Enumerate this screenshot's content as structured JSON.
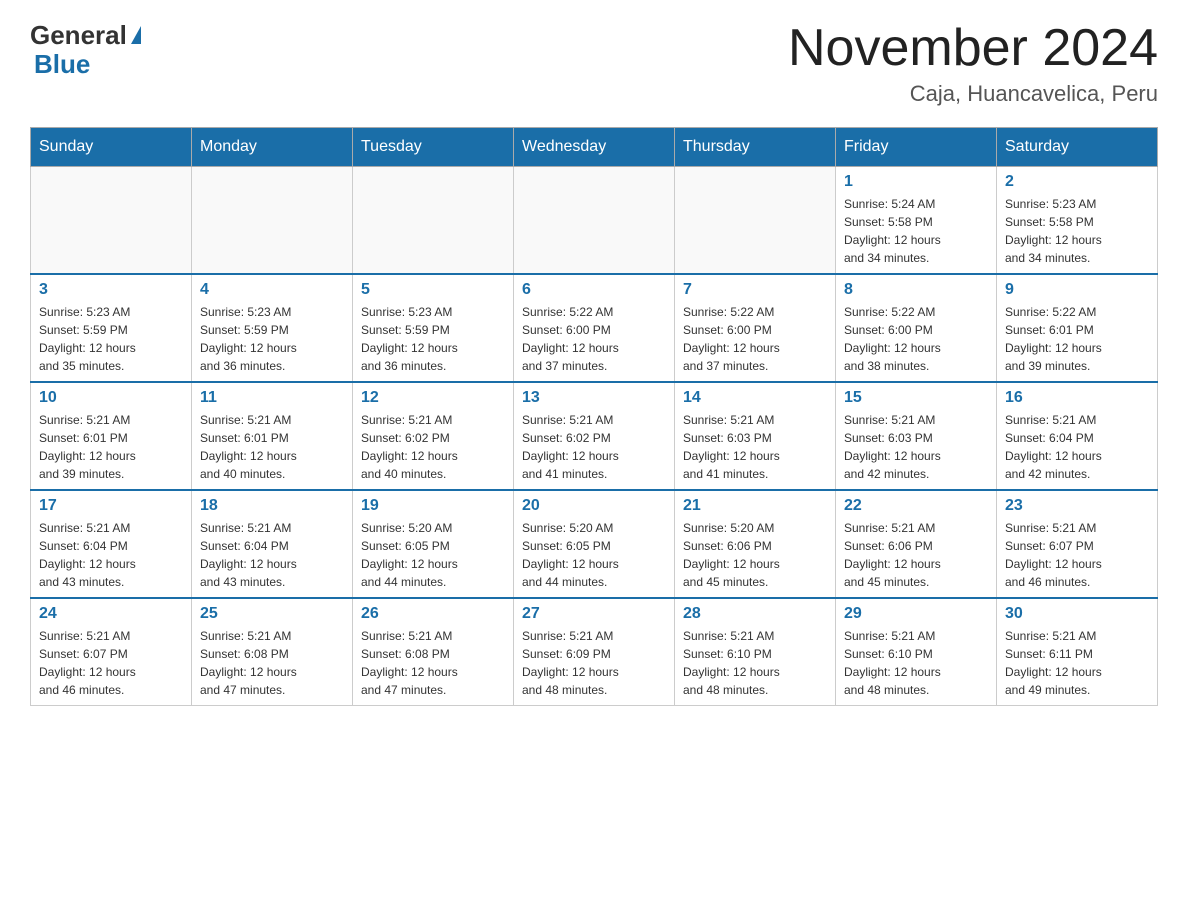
{
  "header": {
    "logo_general": "General",
    "logo_blue": "Blue",
    "month_title": "November 2024",
    "location": "Caja, Huancavelica, Peru"
  },
  "weekdays": [
    "Sunday",
    "Monday",
    "Tuesday",
    "Wednesday",
    "Thursday",
    "Friday",
    "Saturday"
  ],
  "weeks": [
    [
      {
        "day": "",
        "info": ""
      },
      {
        "day": "",
        "info": ""
      },
      {
        "day": "",
        "info": ""
      },
      {
        "day": "",
        "info": ""
      },
      {
        "day": "",
        "info": ""
      },
      {
        "day": "1",
        "info": "Sunrise: 5:24 AM\nSunset: 5:58 PM\nDaylight: 12 hours\nand 34 minutes."
      },
      {
        "day": "2",
        "info": "Sunrise: 5:23 AM\nSunset: 5:58 PM\nDaylight: 12 hours\nand 34 minutes."
      }
    ],
    [
      {
        "day": "3",
        "info": "Sunrise: 5:23 AM\nSunset: 5:59 PM\nDaylight: 12 hours\nand 35 minutes."
      },
      {
        "day": "4",
        "info": "Sunrise: 5:23 AM\nSunset: 5:59 PM\nDaylight: 12 hours\nand 36 minutes."
      },
      {
        "day": "5",
        "info": "Sunrise: 5:23 AM\nSunset: 5:59 PM\nDaylight: 12 hours\nand 36 minutes."
      },
      {
        "day": "6",
        "info": "Sunrise: 5:22 AM\nSunset: 6:00 PM\nDaylight: 12 hours\nand 37 minutes."
      },
      {
        "day": "7",
        "info": "Sunrise: 5:22 AM\nSunset: 6:00 PM\nDaylight: 12 hours\nand 37 minutes."
      },
      {
        "day": "8",
        "info": "Sunrise: 5:22 AM\nSunset: 6:00 PM\nDaylight: 12 hours\nand 38 minutes."
      },
      {
        "day": "9",
        "info": "Sunrise: 5:22 AM\nSunset: 6:01 PM\nDaylight: 12 hours\nand 39 minutes."
      }
    ],
    [
      {
        "day": "10",
        "info": "Sunrise: 5:21 AM\nSunset: 6:01 PM\nDaylight: 12 hours\nand 39 minutes."
      },
      {
        "day": "11",
        "info": "Sunrise: 5:21 AM\nSunset: 6:01 PM\nDaylight: 12 hours\nand 40 minutes."
      },
      {
        "day": "12",
        "info": "Sunrise: 5:21 AM\nSunset: 6:02 PM\nDaylight: 12 hours\nand 40 minutes."
      },
      {
        "day": "13",
        "info": "Sunrise: 5:21 AM\nSunset: 6:02 PM\nDaylight: 12 hours\nand 41 minutes."
      },
      {
        "day": "14",
        "info": "Sunrise: 5:21 AM\nSunset: 6:03 PM\nDaylight: 12 hours\nand 41 minutes."
      },
      {
        "day": "15",
        "info": "Sunrise: 5:21 AM\nSunset: 6:03 PM\nDaylight: 12 hours\nand 42 minutes."
      },
      {
        "day": "16",
        "info": "Sunrise: 5:21 AM\nSunset: 6:04 PM\nDaylight: 12 hours\nand 42 minutes."
      }
    ],
    [
      {
        "day": "17",
        "info": "Sunrise: 5:21 AM\nSunset: 6:04 PM\nDaylight: 12 hours\nand 43 minutes."
      },
      {
        "day": "18",
        "info": "Sunrise: 5:21 AM\nSunset: 6:04 PM\nDaylight: 12 hours\nand 43 minutes."
      },
      {
        "day": "19",
        "info": "Sunrise: 5:20 AM\nSunset: 6:05 PM\nDaylight: 12 hours\nand 44 minutes."
      },
      {
        "day": "20",
        "info": "Sunrise: 5:20 AM\nSunset: 6:05 PM\nDaylight: 12 hours\nand 44 minutes."
      },
      {
        "day": "21",
        "info": "Sunrise: 5:20 AM\nSunset: 6:06 PM\nDaylight: 12 hours\nand 45 minutes."
      },
      {
        "day": "22",
        "info": "Sunrise: 5:21 AM\nSunset: 6:06 PM\nDaylight: 12 hours\nand 45 minutes."
      },
      {
        "day": "23",
        "info": "Sunrise: 5:21 AM\nSunset: 6:07 PM\nDaylight: 12 hours\nand 46 minutes."
      }
    ],
    [
      {
        "day": "24",
        "info": "Sunrise: 5:21 AM\nSunset: 6:07 PM\nDaylight: 12 hours\nand 46 minutes."
      },
      {
        "day": "25",
        "info": "Sunrise: 5:21 AM\nSunset: 6:08 PM\nDaylight: 12 hours\nand 47 minutes."
      },
      {
        "day": "26",
        "info": "Sunrise: 5:21 AM\nSunset: 6:08 PM\nDaylight: 12 hours\nand 47 minutes."
      },
      {
        "day": "27",
        "info": "Sunrise: 5:21 AM\nSunset: 6:09 PM\nDaylight: 12 hours\nand 48 minutes."
      },
      {
        "day": "28",
        "info": "Sunrise: 5:21 AM\nSunset: 6:10 PM\nDaylight: 12 hours\nand 48 minutes."
      },
      {
        "day": "29",
        "info": "Sunrise: 5:21 AM\nSunset: 6:10 PM\nDaylight: 12 hours\nand 48 minutes."
      },
      {
        "day": "30",
        "info": "Sunrise: 5:21 AM\nSunset: 6:11 PM\nDaylight: 12 hours\nand 49 minutes."
      }
    ]
  ]
}
